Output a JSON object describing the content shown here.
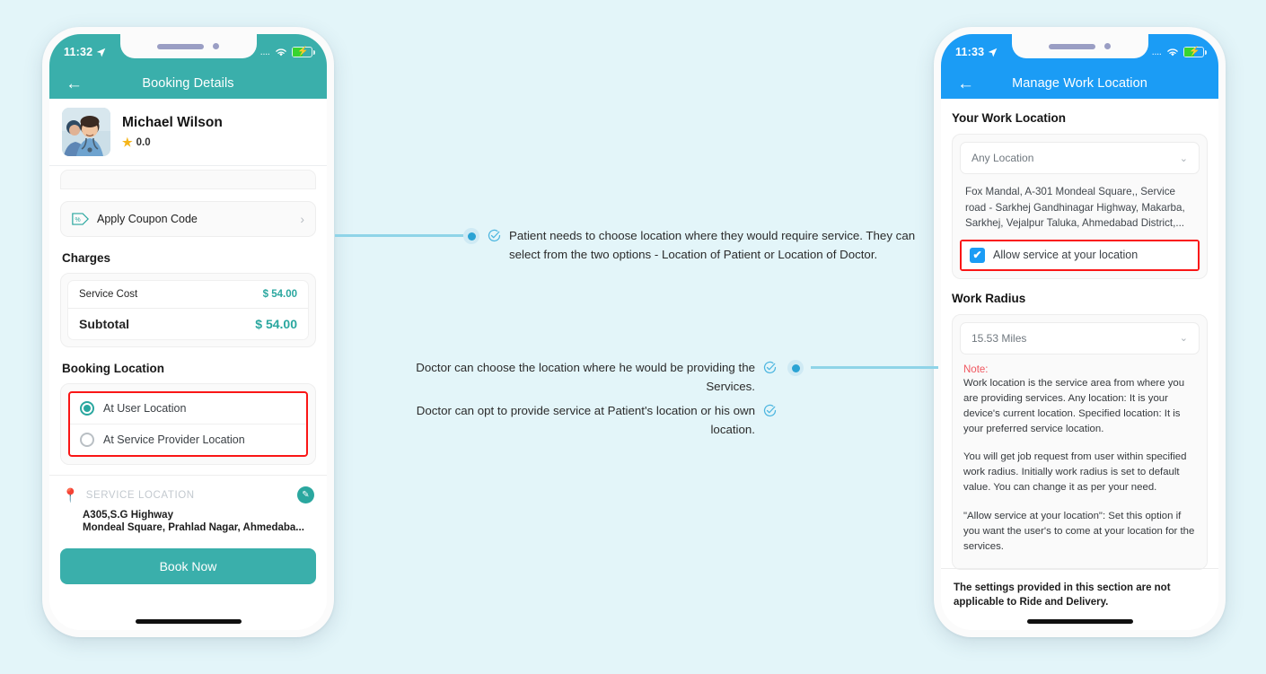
{
  "background_color": "#e3f5f9",
  "left_phone": {
    "theme_color": "#3aafab",
    "status_bar": {
      "time": "11:32",
      "location_icon": "location-arrow-icon",
      "signal": "....",
      "wifi_icon": "wifi-icon",
      "battery_icon": "battery-charging-icon"
    },
    "nav": {
      "back_icon": "back-arrow-icon",
      "title": "Booking Details"
    },
    "doctor": {
      "name": "Michael Wilson",
      "rating": "0.0",
      "star_icon": "star-icon",
      "avatar": "doctor-avatar"
    },
    "coupon": {
      "icon": "coupon-percent-icon",
      "label": "Apply Coupon Code",
      "chevron": "chevron-right-icon"
    },
    "charges": {
      "section_title": "Charges",
      "rows": [
        {
          "label": "Service Cost",
          "value": "$ 54.00"
        },
        {
          "label": "Subtotal",
          "value": "$ 54.00"
        }
      ]
    },
    "booking_location": {
      "section_title": "Booking Location",
      "options": [
        {
          "label": "At User Location",
          "selected": true
        },
        {
          "label": "At Service Provider Location",
          "selected": false
        }
      ]
    },
    "service_location": {
      "pin_icon": "map-pin-icon",
      "caption": "SERVICE LOCATION",
      "edit_icon": "edit-badge-icon",
      "address_line1": "A305,S.G Highway",
      "address_line2": "Mondeal Square, Prahlad Nagar, Ahmedaba..."
    },
    "book_button": "Book Now"
  },
  "right_phone": {
    "theme_color": "#1b9cf5",
    "status_bar": {
      "time": "11:33",
      "location_icon": "location-arrow-icon",
      "signal": "....",
      "wifi_icon": "wifi-icon",
      "battery_icon": "battery-charging-icon"
    },
    "nav": {
      "back_icon": "back-arrow-icon",
      "title": "Manage Work Location"
    },
    "work_location": {
      "section_title": "Your Work Location",
      "select_value": "Any Location",
      "chevron": "chevron-down-icon",
      "address": "Fox Mandal, A-301 Mondeal Square,, Service road - Sarkhej Gandhinagar Highway, Makarba, Sarkhej, Vejalpur Taluka, Ahmedabad District,...",
      "checkbox_label": "Allow service at your location",
      "checkbox_checked": true
    },
    "work_radius": {
      "section_title": "Work Radius",
      "select_value": "15.53 Miles",
      "chevron": "chevron-down-icon",
      "note_label": "Note:",
      "note_paragraphs": [
        "Work location is the service area from where you are providing services. Any location: It is your device's current location. Specified location: It is your preferred service location.",
        "You will get job request from user within specified work radius. Initially work radius is set to default value. You can change it as per your need.",
        "\"Allow service at your location\": Set this option if you want the user's to come at your location for the services."
      ]
    },
    "footer_note": "The settings provided in this section are not applicable to Ride and Delivery."
  },
  "annotations": {
    "accent_color": "#2aa3d4",
    "left_callout": {
      "tick_icon": "check-circle-icon",
      "text": "Patient needs to choose location where they would require service. They can select from the two options - Location of Patient or Location of Doctor."
    },
    "right_callout_1": {
      "tick_icon": "check-circle-icon",
      "text": "Doctor can choose the location where he would be providing the Services."
    },
    "right_callout_2": {
      "tick_icon": "check-circle-icon",
      "text": "Doctor can opt to provide service at Patient's location or his own location."
    }
  }
}
